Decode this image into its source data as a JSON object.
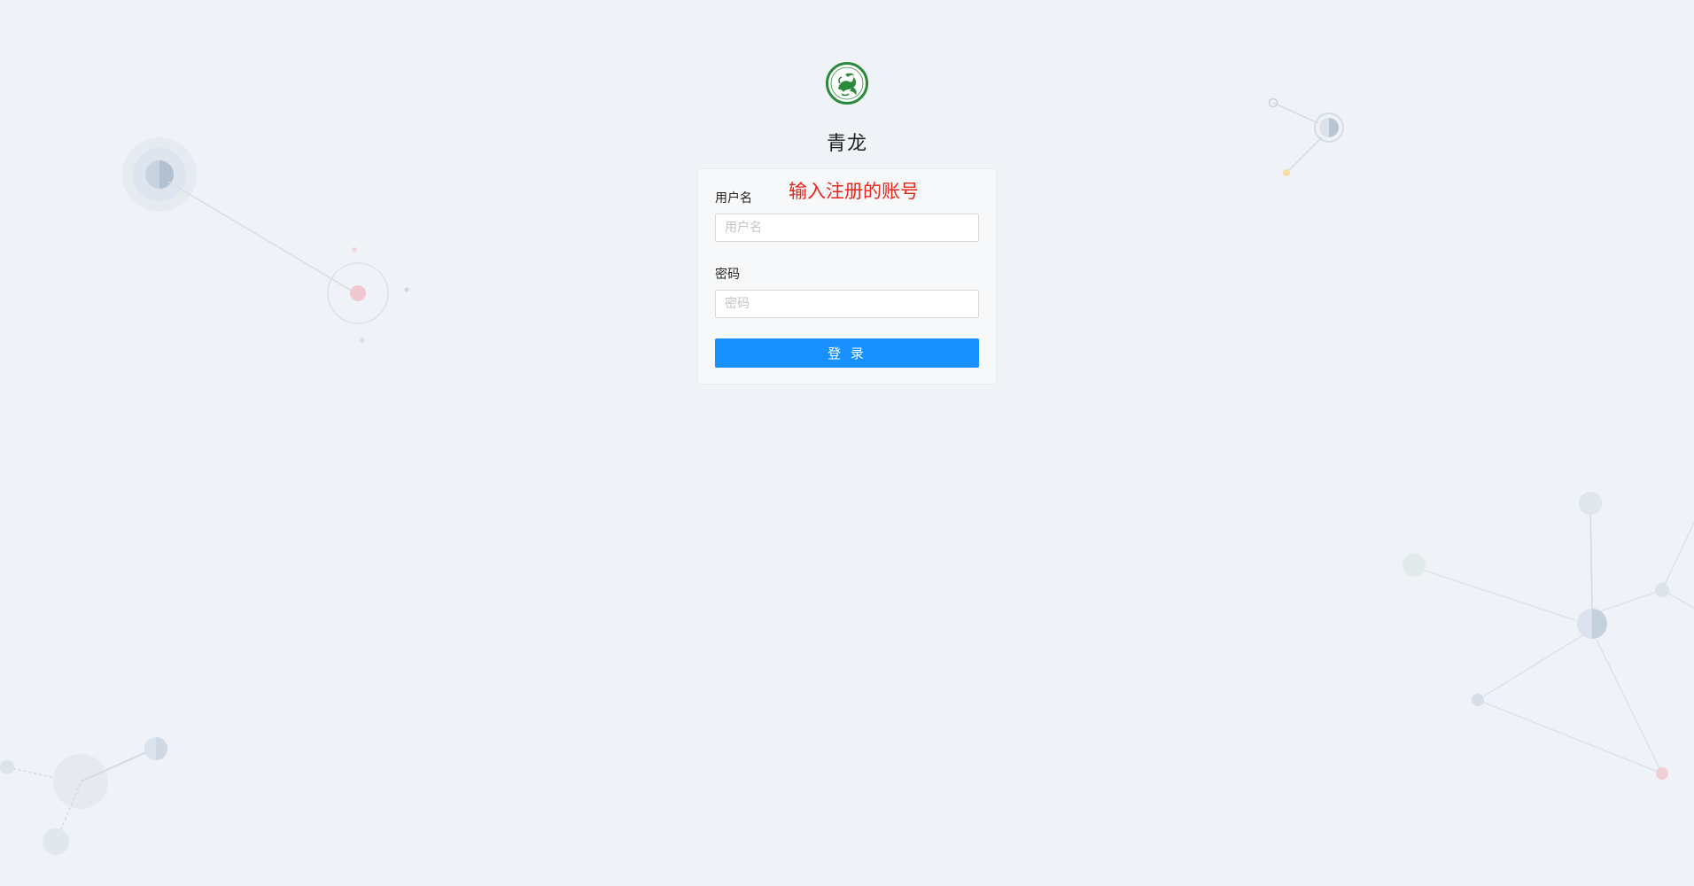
{
  "app": {
    "title": "青龙",
    "brand_color": "#2a8a3a"
  },
  "form": {
    "username_label": "用户名",
    "username_placeholder": "用户名",
    "username_value": "",
    "password_label": "密码",
    "password_placeholder": "密码",
    "password_value": "",
    "submit_label": "登 录",
    "accent_color": "#1890ff"
  },
  "annotation": {
    "text": "输入注册的账号",
    "color": "#e8261a"
  },
  "icons": {
    "logo": "dragon-logo-icon"
  }
}
